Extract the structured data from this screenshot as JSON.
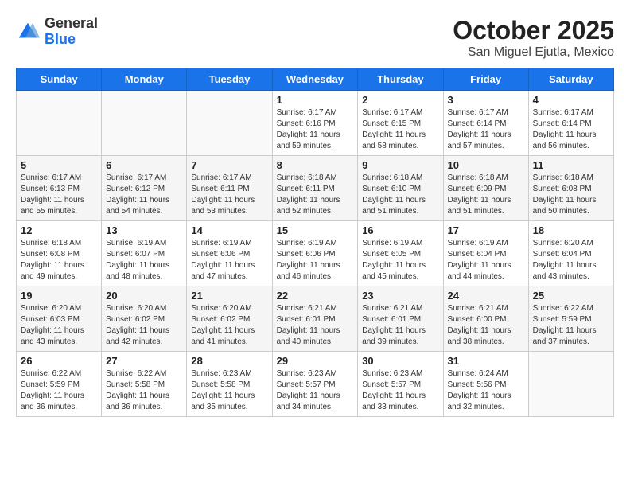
{
  "header": {
    "logo_general": "General",
    "logo_blue": "Blue",
    "month_title": "October 2025",
    "subtitle": "San Miguel Ejutla, Mexico"
  },
  "days_of_week": [
    "Sunday",
    "Monday",
    "Tuesday",
    "Wednesday",
    "Thursday",
    "Friday",
    "Saturday"
  ],
  "weeks": [
    [
      {
        "day": "",
        "info": ""
      },
      {
        "day": "",
        "info": ""
      },
      {
        "day": "",
        "info": ""
      },
      {
        "day": "1",
        "info": "Sunrise: 6:17 AM\nSunset: 6:16 PM\nDaylight: 11 hours and 59 minutes."
      },
      {
        "day": "2",
        "info": "Sunrise: 6:17 AM\nSunset: 6:15 PM\nDaylight: 11 hours and 58 minutes."
      },
      {
        "day": "3",
        "info": "Sunrise: 6:17 AM\nSunset: 6:14 PM\nDaylight: 11 hours and 57 minutes."
      },
      {
        "day": "4",
        "info": "Sunrise: 6:17 AM\nSunset: 6:14 PM\nDaylight: 11 hours and 56 minutes."
      }
    ],
    [
      {
        "day": "5",
        "info": "Sunrise: 6:17 AM\nSunset: 6:13 PM\nDaylight: 11 hours and 55 minutes."
      },
      {
        "day": "6",
        "info": "Sunrise: 6:17 AM\nSunset: 6:12 PM\nDaylight: 11 hours and 54 minutes."
      },
      {
        "day": "7",
        "info": "Sunrise: 6:17 AM\nSunset: 6:11 PM\nDaylight: 11 hours and 53 minutes."
      },
      {
        "day": "8",
        "info": "Sunrise: 6:18 AM\nSunset: 6:11 PM\nDaylight: 11 hours and 52 minutes."
      },
      {
        "day": "9",
        "info": "Sunrise: 6:18 AM\nSunset: 6:10 PM\nDaylight: 11 hours and 51 minutes."
      },
      {
        "day": "10",
        "info": "Sunrise: 6:18 AM\nSunset: 6:09 PM\nDaylight: 11 hours and 51 minutes."
      },
      {
        "day": "11",
        "info": "Sunrise: 6:18 AM\nSunset: 6:08 PM\nDaylight: 11 hours and 50 minutes."
      }
    ],
    [
      {
        "day": "12",
        "info": "Sunrise: 6:18 AM\nSunset: 6:08 PM\nDaylight: 11 hours and 49 minutes."
      },
      {
        "day": "13",
        "info": "Sunrise: 6:19 AM\nSunset: 6:07 PM\nDaylight: 11 hours and 48 minutes."
      },
      {
        "day": "14",
        "info": "Sunrise: 6:19 AM\nSunset: 6:06 PM\nDaylight: 11 hours and 47 minutes."
      },
      {
        "day": "15",
        "info": "Sunrise: 6:19 AM\nSunset: 6:06 PM\nDaylight: 11 hours and 46 minutes."
      },
      {
        "day": "16",
        "info": "Sunrise: 6:19 AM\nSunset: 6:05 PM\nDaylight: 11 hours and 45 minutes."
      },
      {
        "day": "17",
        "info": "Sunrise: 6:19 AM\nSunset: 6:04 PM\nDaylight: 11 hours and 44 minutes."
      },
      {
        "day": "18",
        "info": "Sunrise: 6:20 AM\nSunset: 6:04 PM\nDaylight: 11 hours and 43 minutes."
      }
    ],
    [
      {
        "day": "19",
        "info": "Sunrise: 6:20 AM\nSunset: 6:03 PM\nDaylight: 11 hours and 43 minutes."
      },
      {
        "day": "20",
        "info": "Sunrise: 6:20 AM\nSunset: 6:02 PM\nDaylight: 11 hours and 42 minutes."
      },
      {
        "day": "21",
        "info": "Sunrise: 6:20 AM\nSunset: 6:02 PM\nDaylight: 11 hours and 41 minutes."
      },
      {
        "day": "22",
        "info": "Sunrise: 6:21 AM\nSunset: 6:01 PM\nDaylight: 11 hours and 40 minutes."
      },
      {
        "day": "23",
        "info": "Sunrise: 6:21 AM\nSunset: 6:01 PM\nDaylight: 11 hours and 39 minutes."
      },
      {
        "day": "24",
        "info": "Sunrise: 6:21 AM\nSunset: 6:00 PM\nDaylight: 11 hours and 38 minutes."
      },
      {
        "day": "25",
        "info": "Sunrise: 6:22 AM\nSunset: 5:59 PM\nDaylight: 11 hours and 37 minutes."
      }
    ],
    [
      {
        "day": "26",
        "info": "Sunrise: 6:22 AM\nSunset: 5:59 PM\nDaylight: 11 hours and 36 minutes."
      },
      {
        "day": "27",
        "info": "Sunrise: 6:22 AM\nSunset: 5:58 PM\nDaylight: 11 hours and 36 minutes."
      },
      {
        "day": "28",
        "info": "Sunrise: 6:23 AM\nSunset: 5:58 PM\nDaylight: 11 hours and 35 minutes."
      },
      {
        "day": "29",
        "info": "Sunrise: 6:23 AM\nSunset: 5:57 PM\nDaylight: 11 hours and 34 minutes."
      },
      {
        "day": "30",
        "info": "Sunrise: 6:23 AM\nSunset: 5:57 PM\nDaylight: 11 hours and 33 minutes."
      },
      {
        "day": "31",
        "info": "Sunrise: 6:24 AM\nSunset: 5:56 PM\nDaylight: 11 hours and 32 minutes."
      },
      {
        "day": "",
        "info": ""
      }
    ]
  ]
}
